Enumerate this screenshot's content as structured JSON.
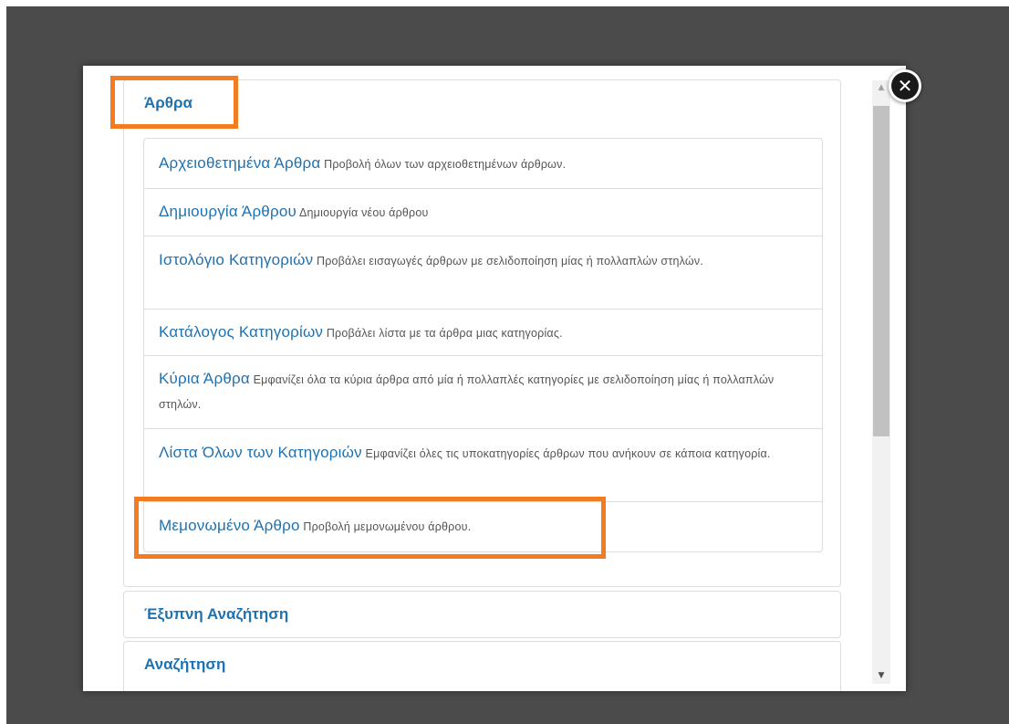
{
  "modal": {
    "close_icon": "close-icon",
    "close_glyph": "✕",
    "scroll_up_glyph": "▲",
    "scroll_down_glyph": "▼"
  },
  "groups": [
    {
      "title": "Άρθρα",
      "items": [
        {
          "title": "Αρχειοθετημένα Άρθρα",
          "desc": "Προβολή όλων των αρχειοθετημένων άρθρων."
        },
        {
          "title": "Δημιουργία Άρθρου",
          "desc": "Δημιουργία νέου άρθρου"
        },
        {
          "title": "Ιστολόγιο Κατηγοριών",
          "desc": "Προβάλει εισαγωγές άρθρων με σελιδοποίηση μίας ή πολλαπλών στηλών."
        },
        {
          "title": "Κατάλογος Κατηγορίων",
          "desc": "Προβάλει λίστα με τα άρθρα μιας κατηγορίας."
        },
        {
          "title": "Κύρια Άρθρα",
          "desc": "Εμφανίζει όλα τα κύρια άρθρα από μία ή πολλαπλές κατηγορίες με σελιδοποίηση μίας ή πολλαπλών στηλών."
        },
        {
          "title": "Λίστα Όλων των Κατηγοριών",
          "desc": "Εμφανίζει όλες τις υποκατηγορίες άρθρων που ανήκουν σε κάποια κατηγορία."
        },
        {
          "title": "Μεμονωμένο Άρθρο",
          "desc": "Προβολή μεμονωμένου άρθρου."
        }
      ]
    },
    {
      "title": "Έξυπνη Αναζήτηση"
    },
    {
      "title": "Αναζήτηση"
    }
  ],
  "highlight_color": "#f47b20",
  "link_color": "#1f72b0"
}
